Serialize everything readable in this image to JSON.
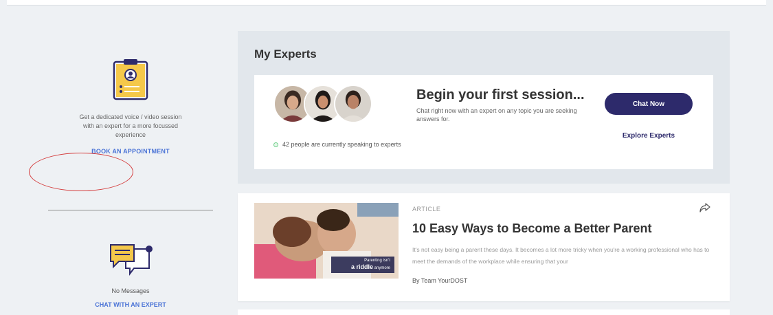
{
  "sidebar": {
    "appointment_desc": "Get a dedicated voice / video session with an expert for a more focussed experience",
    "book_label": "BOOK AN APPOINTMENT",
    "no_messages": "No Messages",
    "chat_expert_label": "CHAT WITH AN EXPERT"
  },
  "experts": {
    "title": "My Experts",
    "speaking_text": "42 people are currently speaking to experts",
    "session_title": "Begin your first session...",
    "session_desc": "Chat right now with an expert on any topic you are seeking answers for.",
    "chat_now_label": "Chat Now",
    "explore_label": "Explore Experts"
  },
  "article": {
    "tag": "ARTICLE",
    "title": "10 Easy Ways to Become a Better Parent",
    "excerpt": "It's not easy being a parent these days. It becomes a lot more tricky when you're a working professional who has to meet the demands of the workplace while ensuring that your",
    "author": "By Team YourDOST",
    "thumb_caption_small": "Parenting isn't",
    "thumb_caption_big": "a riddle",
    "thumb_caption_tail": "anymore"
  },
  "colors": {
    "accent_blue": "#4a73d6",
    "brand_navy": "#2d2a6b",
    "annotation_red": "#d43c3c"
  },
  "icons": {
    "appointment": "clipboard-user-icon",
    "messages": "chat-bubbles-icon",
    "share": "share-arrow-icon"
  }
}
